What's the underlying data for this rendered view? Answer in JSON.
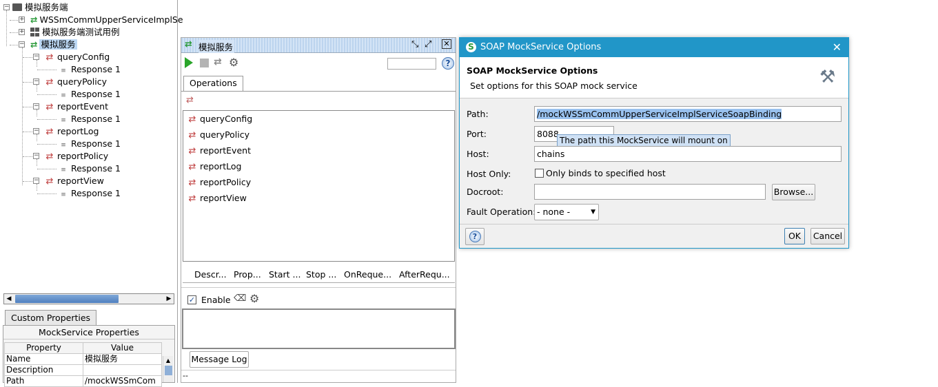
{
  "tree": {
    "root": "模拟服务端",
    "interface": "WSSmCommUpperServiceImplSe",
    "testsuite": "模拟服务端测试用例",
    "mockservice": "模拟服务",
    "operations": [
      {
        "name": "queryConfig",
        "response": "Response 1"
      },
      {
        "name": "queryPolicy",
        "response": "Response 1"
      },
      {
        "name": "reportEvent",
        "response": "Response 1"
      },
      {
        "name": "reportLog",
        "response": "Response 1"
      },
      {
        "name": "reportPolicy",
        "response": "Response 1"
      },
      {
        "name": "reportView",
        "response": "Response 1"
      }
    ]
  },
  "props_panel": {
    "tab": "Custom Properties",
    "title": "MockService Properties",
    "col_property": "Property",
    "col_value": "Value",
    "rows": [
      {
        "name": "Name",
        "value": "模拟服务"
      },
      {
        "name": "Description",
        "value": ""
      },
      {
        "name": "Path",
        "value": "/mockWSSmCom"
      }
    ]
  },
  "mock_panel": {
    "title": "模拟服务",
    "tab_operations": "Operations",
    "operations": [
      "queryConfig",
      "queryPolicy",
      "reportEvent",
      "reportLog",
      "reportPolicy",
      "reportView"
    ],
    "bottom_tabs": [
      "Descr...",
      "Prop...",
      "Start ...",
      "Stop ...",
      "OnReque...",
      "AfterRequ..."
    ],
    "enable_label": "Enable",
    "message_log": "Message Log",
    "status": "--"
  },
  "dialog": {
    "title": "SOAP MockService Options",
    "heading": "SOAP MockService Options",
    "subheading": "Set options for this SOAP mock service",
    "path_label": "Path:",
    "path_value": "/mockWSSmCommUpperServiceImplServiceSoapBinding",
    "port_label": "Port:",
    "port_value": "8088",
    "tooltip": "The path this MockService will mount on",
    "host_label": "Host:",
    "host_value": "chains",
    "hostonly_label": "Host Only:",
    "hostonly_checkbox": "Only binds to specified host",
    "docroot_label": "Docroot:",
    "docroot_value": "",
    "browse_label": "Browse...",
    "fault_label": "Fault Operation:",
    "fault_value": "- none -",
    "ok_label": "OK",
    "cancel_label": "Cancel"
  }
}
